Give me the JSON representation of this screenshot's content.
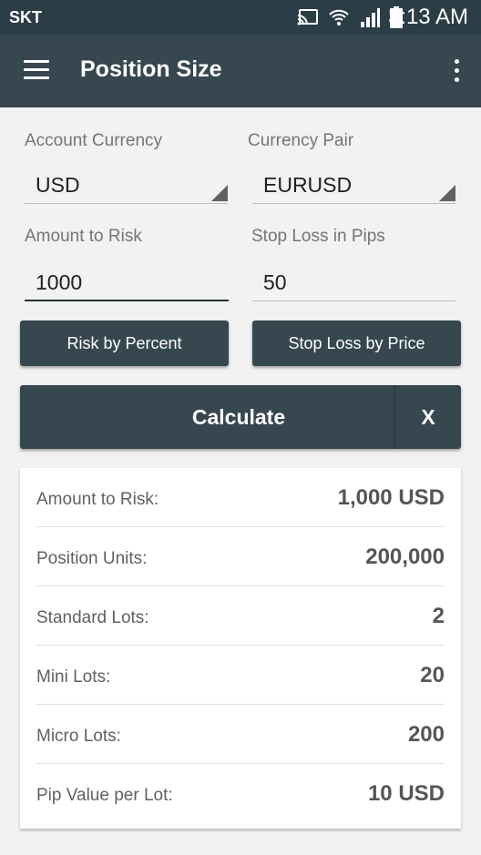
{
  "status_bar": {
    "carrier": "SKT",
    "time": "3:13 AM",
    "icons": [
      "cast-icon",
      "wifi-icon",
      "signal-icon",
      "battery-icon"
    ]
  },
  "app_bar": {
    "title": "Position Size"
  },
  "form": {
    "account_currency_label": "Account Currency",
    "account_currency_value": "USD",
    "currency_pair_label": "Currency Pair",
    "currency_pair_value": "EURUSD",
    "amount_to_risk_label": "Amount to Risk",
    "amount_to_risk_value": "1000",
    "stop_loss_label": "Stop Loss in Pips",
    "stop_loss_value": "50"
  },
  "buttons": {
    "risk_by_percent": "Risk by Percent",
    "stop_loss_by_price": "Stop Loss by Price",
    "calculate": "Calculate",
    "clear": "X"
  },
  "results": [
    {
      "label": "Amount to Risk:",
      "value": "1,000 USD"
    },
    {
      "label": "Position Units:",
      "value": "200,000"
    },
    {
      "label": "Standard Lots:",
      "value": "2"
    },
    {
      "label": "Mini Lots:",
      "value": "20"
    },
    {
      "label": "Micro Lots:",
      "value": "200"
    },
    {
      "label": "Pip Value per Lot:",
      "value": "10 USD"
    }
  ],
  "colors": {
    "status_bar": "#2b3d47",
    "app_bar": "#37474f",
    "button": "#37474f",
    "background": "#f2f2f2"
  }
}
